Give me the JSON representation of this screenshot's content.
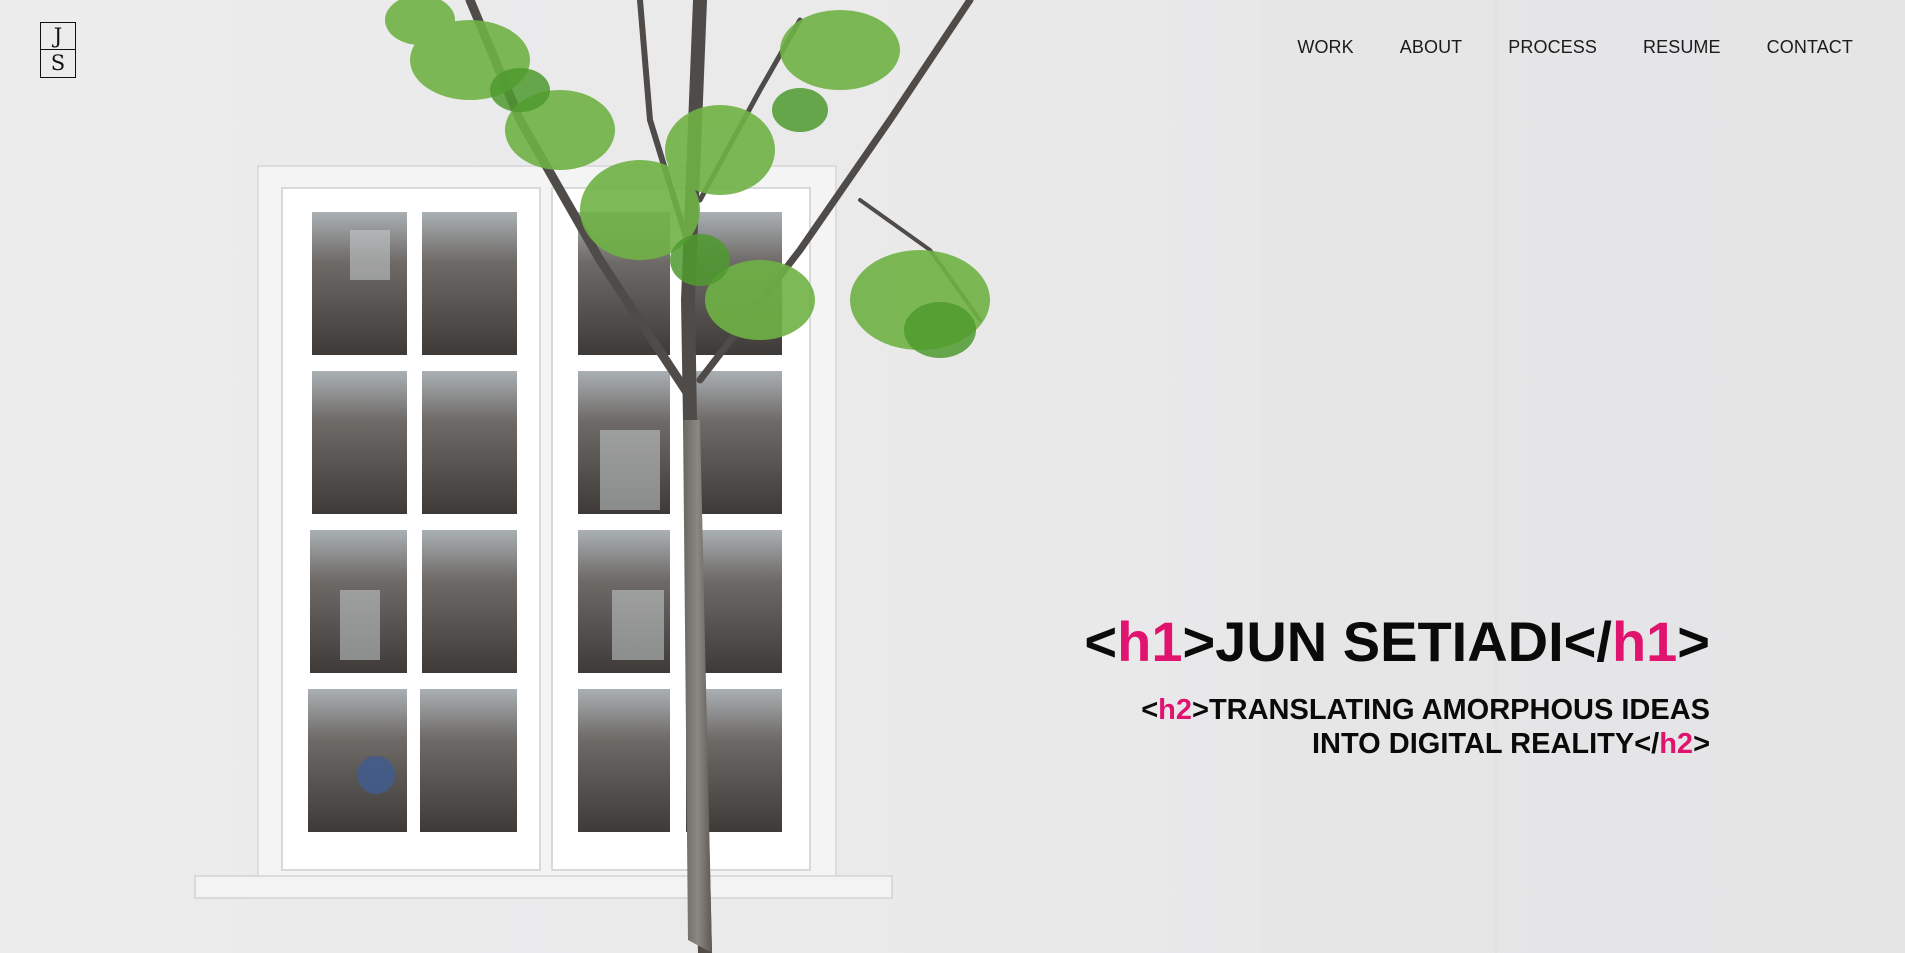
{
  "logo": {
    "top": "J",
    "bottom": "S"
  },
  "nav": {
    "items": [
      {
        "label": "WORK"
      },
      {
        "label": "ABOUT"
      },
      {
        "label": "PROCESS"
      },
      {
        "label": "RESUME"
      },
      {
        "label": "CONTACT"
      }
    ]
  },
  "hero": {
    "h1": {
      "open_lt": "<",
      "open_tag": "h1",
      "open_gt": ">",
      "text": "JUN SETIADI",
      "close_lt": "</",
      "close_tag": "h1",
      "close_gt": ">"
    },
    "h2": {
      "open_lt": "<",
      "open_tag": "h2",
      "open_gt": ">",
      "line1": "TRANSLATING AMORPHOUS IDEAS",
      "line2": "INTO DIGITAL REALITY",
      "close_lt": "</",
      "close_tag": "h2",
      "close_gt": ">"
    }
  },
  "colors": {
    "accent": "#e0136f",
    "text": "#0a0a0a",
    "background": "#e9e9ea"
  },
  "icons": {
    "background_image": "window-and-tree-photo"
  }
}
